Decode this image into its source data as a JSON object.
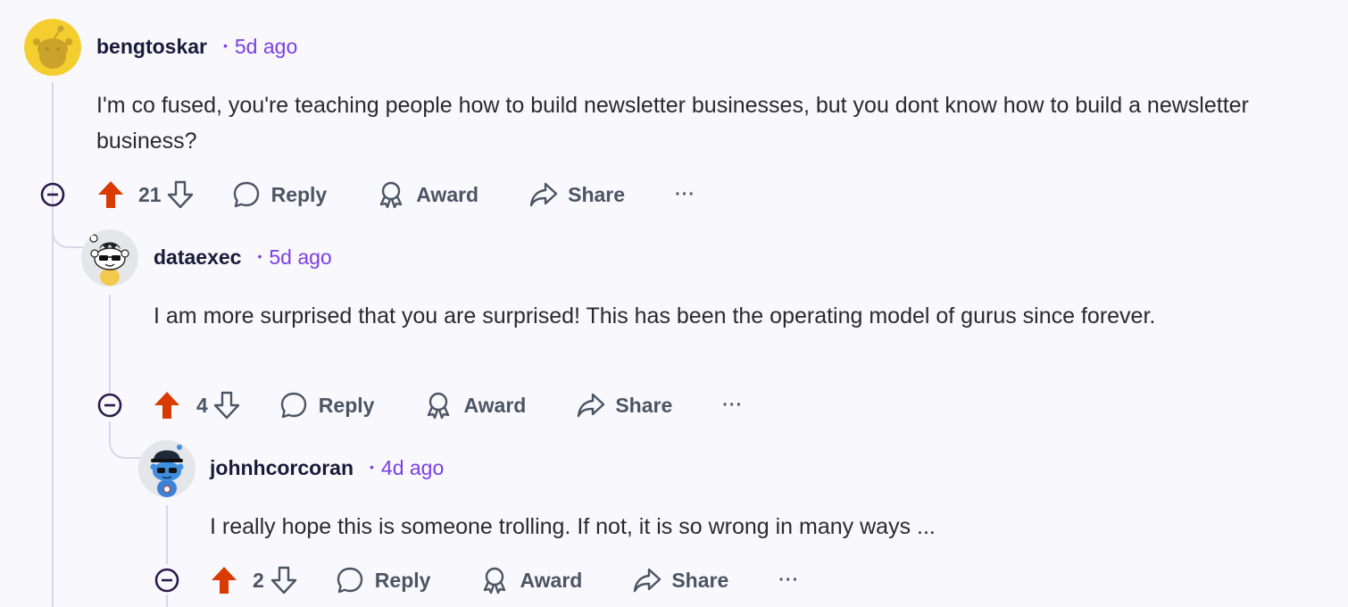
{
  "comments": [
    {
      "username": "bengtoskar",
      "time_ago": "5d ago",
      "body": "I'm co fused, you're teaching people how to build newsletter businesses, but you dont know how to build a newsletter business?",
      "score": "21",
      "avatar_icon": "snoo-avatar-yellow-icon"
    },
    {
      "username": "dataexec",
      "time_ago": "5d ago",
      "body": "I am more surprised that you are surprised! This has been the operating model of gurus since forever.",
      "score": "4",
      "avatar_icon": "snoo-avatar-sunglasses-icon"
    },
    {
      "username": "johnhcorcoran",
      "time_ago": "4d ago",
      "body": "I really hope this is someone trolling. If not, it is so wrong in many ways ...",
      "score": "2",
      "avatar_icon": "snoo-avatar-blue-hat-icon"
    }
  ],
  "actions": {
    "reply_label": "Reply",
    "award_label": "Award",
    "share_label": "Share",
    "more_label": "···"
  },
  "colors": {
    "upvote": "#d93a00",
    "timestamp": "#7b3fe4",
    "username": "#1a1a3a",
    "thread_line": "#d9d6e8",
    "background": "#f9f8fd"
  }
}
